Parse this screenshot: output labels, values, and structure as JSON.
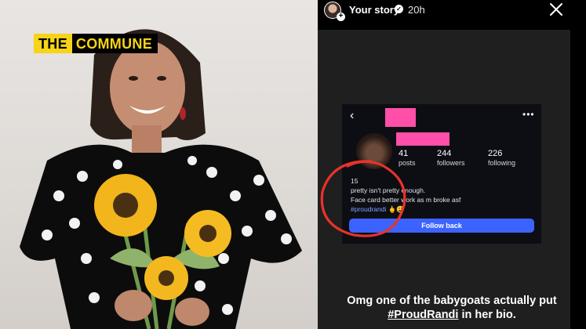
{
  "brand": {
    "the": "THE",
    "commune": "COMMUNE"
  },
  "story": {
    "title": "Your story",
    "time": "20h",
    "close_icon": "close-icon"
  },
  "profile": {
    "stats": [
      {
        "num": "41",
        "label": "posts"
      },
      {
        "num": "244",
        "label": "followers"
      },
      {
        "num": "226",
        "label": "following"
      }
    ],
    "bio": {
      "line1": "15",
      "line2": "pretty isn't pretty enough.",
      "line3": "Face card better work as m broke asf",
      "tag": "#proudrandi",
      "emoji": "🖕😩"
    },
    "follow_back": "Follow back"
  },
  "caption": {
    "prefix": "Omg one of the babygoats actually put",
    "hashtag": "#ProudRandi",
    "suffix": "in her bio."
  },
  "colors": {
    "brand_yellow": "#f7d417",
    "redaction_pink": "#ff4fa8",
    "follow_blue": "#3d63ff",
    "annotation_red": "#e8322a"
  }
}
